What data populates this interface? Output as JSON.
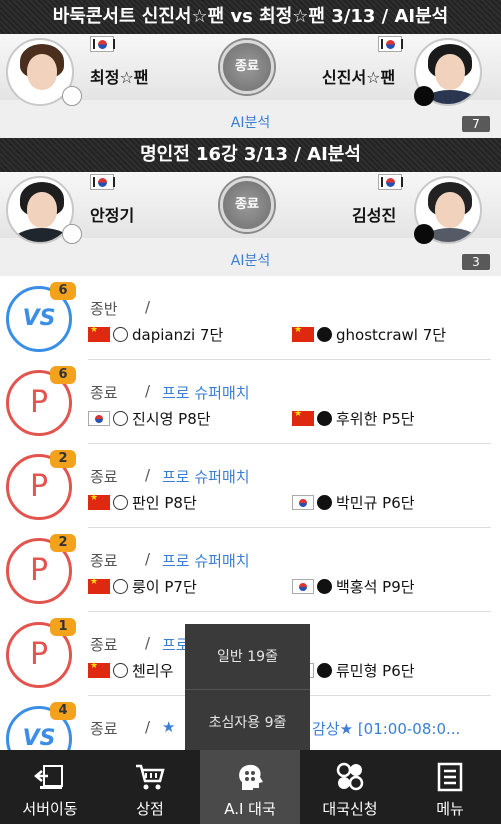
{
  "featured": [
    {
      "title": "바둑콘서트 신진서☆팬 vs 최정☆팬 3/13 / AI분석",
      "left_player": "최정☆팬",
      "right_player": "신진서☆팬",
      "status": "종료",
      "ai_link": "AI분석",
      "count": "7"
    },
    {
      "title": "명인전 16강 3/13 / AI분석",
      "left_player": "안정기",
      "right_player": "김성진",
      "status": "종료",
      "ai_link": "AI분석",
      "count": "3"
    }
  ],
  "games": [
    {
      "icon": "VS",
      "badge": "6",
      "status": "종반",
      "slash": "/",
      "title": "",
      "white": "dapianzi 7단",
      "black": "ghostcrawl 7단",
      "white_flag": "cn",
      "black_flag": "cn"
    },
    {
      "icon": "P",
      "badge": "6",
      "status": "종료",
      "slash": "/",
      "title": "프로 슈퍼매치",
      "white": "진시영 P8단",
      "black": "후위한 P5단",
      "white_flag": "kr",
      "black_flag": "cn"
    },
    {
      "icon": "P",
      "badge": "2",
      "status": "종료",
      "slash": "/",
      "title": "프로 슈퍼매치",
      "white": "판인 P8단",
      "black": "박민규 P6단",
      "white_flag": "cn",
      "black_flag": "kr"
    },
    {
      "icon": "P",
      "badge": "2",
      "status": "종료",
      "slash": "/",
      "title": "프로 슈퍼매치",
      "white": "룽이 P7단",
      "black": "백홍석 P9단",
      "white_flag": "cn",
      "black_flag": "kr"
    },
    {
      "icon": "P",
      "badge": "1",
      "status": "종료",
      "slash": "/",
      "title": "프로",
      "white": "첸리우",
      "black": "류민형 P6단",
      "white_flag": "cn",
      "black_flag": "kr"
    },
    {
      "icon": "VS",
      "badge": "4",
      "status": "종료",
      "slash": "/",
      "title": "★",
      "title_tail": "감상★ [01:00-08:0...",
      "white": "",
      "black": "",
      "white_flag": "",
      "black_flag": ""
    }
  ],
  "popup": {
    "items": [
      "일반 19줄",
      "초심자용 9줄"
    ]
  },
  "nav": {
    "items": [
      "서버이동",
      "상점",
      "A.I 대국",
      "대국신청",
      "메뉴"
    ],
    "active": "A.I 대국"
  },
  "colors": {
    "accent_blue": "#3a7fd5",
    "pro_red": "#e3544f",
    "vs_blue": "#3a8ee6",
    "badge_orange": "#f4a11c"
  }
}
